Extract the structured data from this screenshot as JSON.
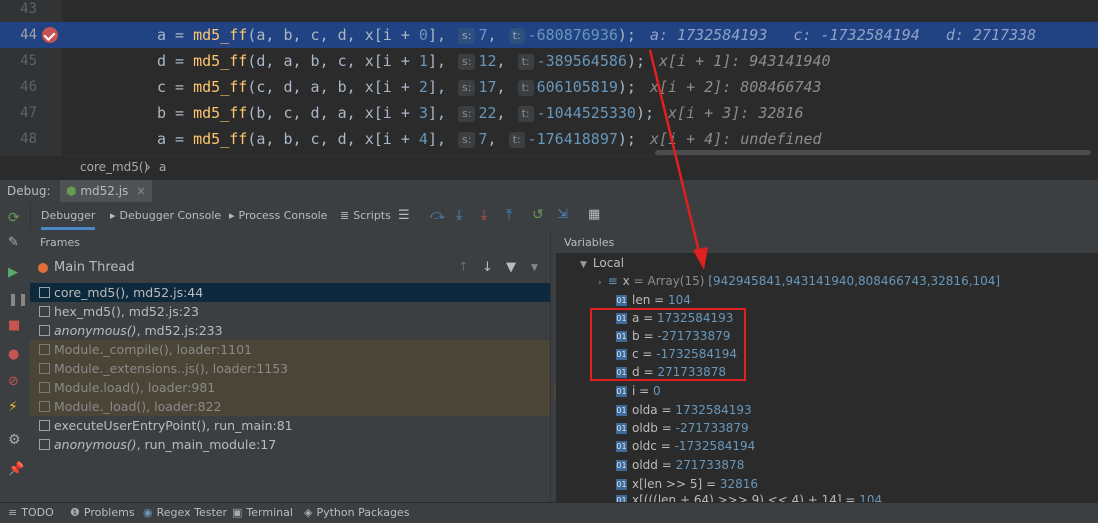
{
  "editor": {
    "lines": [
      {
        "num": "43",
        "highlighted": false,
        "fn": "",
        "args": "",
        "s": "",
        "t": "",
        "tail": ""
      },
      {
        "num": "44",
        "highlighted": true,
        "lhs": "a",
        "fn": "md5_ff",
        "args": [
          "a",
          "b",
          "c",
          "d"
        ],
        "idx": "0",
        "s": "7",
        "t": "-680876936",
        "inline_values": [
          "a: 1732584193",
          "c: -1732584194",
          "d: 2717338"
        ]
      },
      {
        "num": "45",
        "highlighted": false,
        "lhs": "d",
        "fn": "md5_ff",
        "args": [
          "d",
          "a",
          "b",
          "c"
        ],
        "idx": "1",
        "s": "12",
        "t": "-389564586",
        "inline_values": [
          "x[i + 1]: 943141940"
        ]
      },
      {
        "num": "46",
        "highlighted": false,
        "lhs": "c",
        "fn": "md5_ff",
        "args": [
          "c",
          "d",
          "a",
          "b"
        ],
        "idx": "2",
        "s": "17",
        "t": "606105819",
        "inline_values": [
          "x[i + 2]: 808466743"
        ]
      },
      {
        "num": "47",
        "highlighted": false,
        "lhs": "b",
        "fn": "md5_ff",
        "args": [
          "b",
          "c",
          "d",
          "a"
        ],
        "idx": "3",
        "s": "22",
        "t": "-1044525330",
        "inline_values": [
          "x[i + 3]: 32816"
        ]
      },
      {
        "num": "48",
        "highlighted": false,
        "lhs": "a",
        "fn": "md5_ff",
        "args": [
          "a",
          "b",
          "c",
          "d"
        ],
        "idx": "4",
        "s": "7",
        "t": "-176418897",
        "inline_values": [
          "x[i + 4]: undefined"
        ]
      }
    ],
    "hint_s": "s:",
    "hint_t": "t:"
  },
  "breadcrumb": {
    "func": "core_md5()",
    "sep": "›",
    "var": "a"
  },
  "debug": {
    "label": "Debug:",
    "tab": "md52.js",
    "tabs": [
      "Debugger",
      "Debugger Console",
      "Process Console",
      "Scripts"
    ],
    "frames_title": "Frames",
    "thread": "Main Thread",
    "frames": [
      {
        "name": "core_md5()",
        "loc": ", md52.js:44",
        "italic": false,
        "lib": false,
        "selected": true
      },
      {
        "name": "hex_md5()",
        "loc": ", md52.js:23",
        "italic": false,
        "lib": false,
        "selected": false
      },
      {
        "name": "anonymous()",
        "loc": ", md52.js:233",
        "italic": true,
        "lib": false,
        "selected": false
      },
      {
        "name": "Module._compile()",
        "loc": ", loader:1101",
        "italic": false,
        "lib": true,
        "selected": false
      },
      {
        "name": "Module._extensions..js()",
        "loc": ", loader:1153",
        "italic": false,
        "lib": true,
        "selected": false
      },
      {
        "name": "Module.load()",
        "loc": ", loader:981",
        "italic": false,
        "lib": true,
        "selected": false
      },
      {
        "name": "Module._load()",
        "loc": ", loader:822",
        "italic": false,
        "lib": true,
        "selected": false
      },
      {
        "name": "executeUserEntryPoint()",
        "loc": ", run_main:81",
        "italic": false,
        "lib": false,
        "selected": false
      },
      {
        "name": "anonymous()",
        "loc": ", run_main_module:17",
        "italic": true,
        "lib": false,
        "selected": false
      }
    ],
    "variables_title": "Variables",
    "local_label": "Local",
    "x_var": {
      "name": "x",
      "value": "= Array(15)",
      "extra": "[942945841,943141940,808466743,32816,104]"
    },
    "variables": [
      {
        "name": "len",
        "value": "104"
      },
      {
        "name": "a",
        "value": "1732584193"
      },
      {
        "name": "b",
        "value": "-271733879"
      },
      {
        "name": "c",
        "value": "-1732584194"
      },
      {
        "name": "d",
        "value": "271733878"
      },
      {
        "name": "i",
        "value": "0"
      },
      {
        "name": "olda",
        "value": "1732584193"
      },
      {
        "name": "oldb",
        "value": "-271733879"
      },
      {
        "name": "oldc",
        "value": "-1732584194"
      },
      {
        "name": "oldd",
        "value": "271733878"
      },
      {
        "name": "x[len >> 5]",
        "value": "32816"
      },
      {
        "name": "x[(((len + 64) >>> 9) << 4) + 14]",
        "value": "104"
      }
    ]
  },
  "statusbar": [
    "TODO",
    "Problems",
    "Regex Tester",
    "Terminal",
    "Python Packages"
  ],
  "colors": {
    "highlight_line": "#214283",
    "red_annotation": "#e02020",
    "breakpoint": "#c75450"
  }
}
